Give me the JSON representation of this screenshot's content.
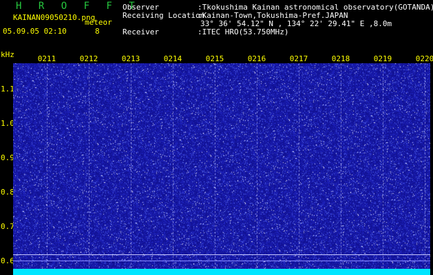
{
  "header": {
    "brand": "H R O F F T",
    "filename": "KAINAN09050210.png",
    "meteor_label": "meteor",
    "date_time": "05.09.05 02:10",
    "meteor_count": "8",
    "observer_label": "Observer",
    "observer_value": ":Tkokushima Kainan astronomical observatory(GOTANDA)",
    "location_label": "Receiving Location",
    "location_value": ":Kainan-Town,Tokushima-Pref.JAPAN",
    "coordinates": "33° 36' 54.12\" N , 134° 22' 29.41\" E ,8.0m",
    "receiver_label": "Receiver",
    "receiver_value": ":ITEC HRO(53.750MHz)"
  },
  "axes": {
    "y_unit": "kHz",
    "x_ticks": [
      "0211",
      "0212",
      "0213",
      "0214",
      "0215",
      "0216",
      "0217",
      "0218",
      "0219",
      "0220"
    ],
    "y_ticks": [
      "1.1",
      "1.0",
      "0.9",
      "0.8",
      "0.7",
      "0.6"
    ]
  },
  "colors": {
    "background": "#000000",
    "spectrogram_base": "#1a1aa8",
    "baseline": "#00e5ff",
    "tick_labels": "#ffff00",
    "brand": "#27c93f"
  }
}
